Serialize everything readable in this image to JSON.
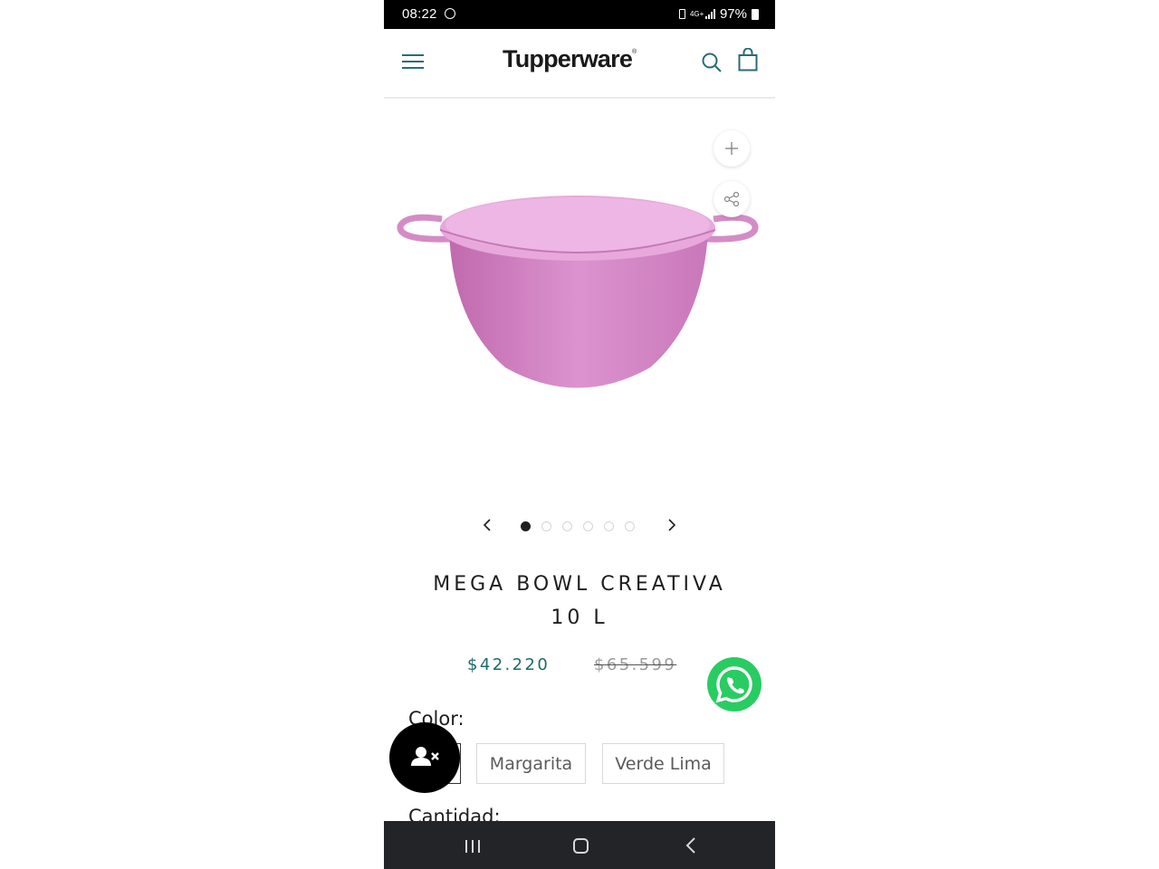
{
  "status_bar": {
    "time": "08:22",
    "battery": "97%",
    "network": "4G+"
  },
  "header": {
    "logo": "Tupperware",
    "logo_mark": "®"
  },
  "product": {
    "title_line1": "MEGA BOWL CREATIVA",
    "title_line2": "10 L",
    "price": "$42.220",
    "compare_price": "$65.599",
    "color_label": "Color:",
    "color_options": [
      "Margarita",
      "Verde Lima"
    ],
    "quantity_label": "Cantidad:",
    "image_color": "#d98ecb"
  },
  "gallery": {
    "image_count": 6,
    "active_index": 0
  },
  "colors": {
    "accent": "#2a6b78",
    "price": "#1d6b6b",
    "whatsapp": "#29cc62"
  }
}
